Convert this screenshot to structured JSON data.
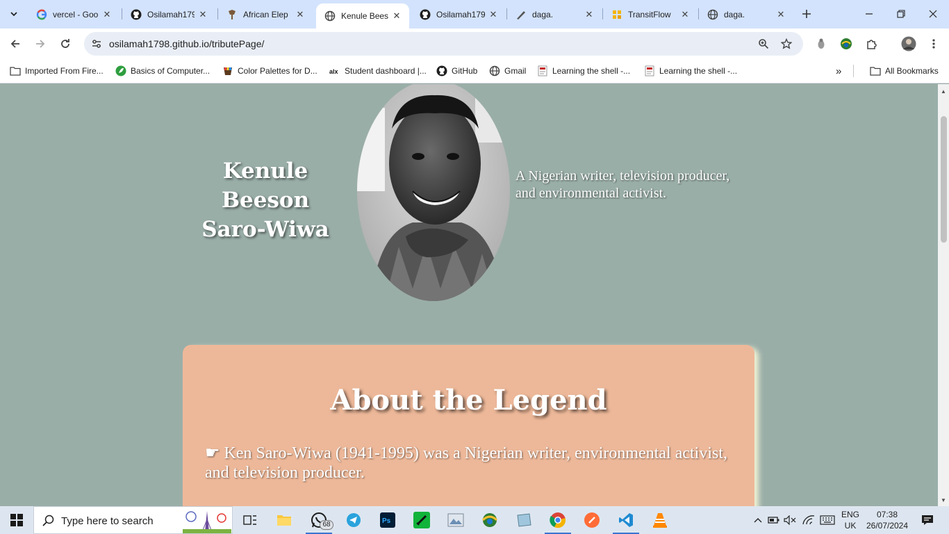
{
  "browser": {
    "tabs": [
      {
        "title": "vercel - Goo",
        "favicon": "google-g-icon",
        "active": false
      },
      {
        "title": "Osilamah179",
        "favicon": "github-icon",
        "active": false
      },
      {
        "title": "African Elep",
        "favicon": "elephant-icon",
        "active": false
      },
      {
        "title": "Kenule Bees",
        "favicon": "globe-icon",
        "active": true
      },
      {
        "title": "Osilamah179",
        "favicon": "github-icon",
        "active": false
      },
      {
        "title": "daga.",
        "favicon": "pen-icon",
        "active": false
      },
      {
        "title": "TransitFlow",
        "favicon": "grid-icon",
        "active": false
      },
      {
        "title": "daga.",
        "favicon": "globe-icon",
        "active": false
      }
    ],
    "url": "osilamah1798.github.io/tributePage/",
    "bookmarks": [
      {
        "label": "Imported From Fire...",
        "icon": "folder-icon"
      },
      {
        "label": "Basics of Computer...",
        "icon": "leaf-icon"
      },
      {
        "label": "Color Palettes for D...",
        "icon": "palette-icon"
      },
      {
        "label": "Student dashboard |...",
        "icon": "alx-icon"
      },
      {
        "label": "GitHub",
        "icon": "github-icon"
      },
      {
        "label": "Gmail",
        "icon": "globe-icon"
      },
      {
        "label": "Learning the shell -...",
        "icon": "doc-icon"
      },
      {
        "label": "Learning the shell -...",
        "icon": "doc-icon"
      }
    ],
    "all_bookmarks_label": "All Bookmarks",
    "overflow_label": "»"
  },
  "page": {
    "hero_name_line1": "Kenule Beeson",
    "hero_name_line2": "Saro-Wiwa",
    "hero_description": "A Nigerian writer, television producer, and environmental activist.",
    "about_title": "About the Legend",
    "about_text": "☛ Ken Saro-Wiwa (1941-1995) was a Nigerian writer, environmental activist, and television producer.",
    "colors": {
      "background": "#9aaea8",
      "card": "#edb899"
    }
  },
  "taskbar": {
    "search_placeholder": "Type here to search",
    "whatsapp_badge": "68",
    "language_line1": "ENG",
    "language_line2": "UK",
    "time": "07:38",
    "date": "26/07/2024"
  }
}
